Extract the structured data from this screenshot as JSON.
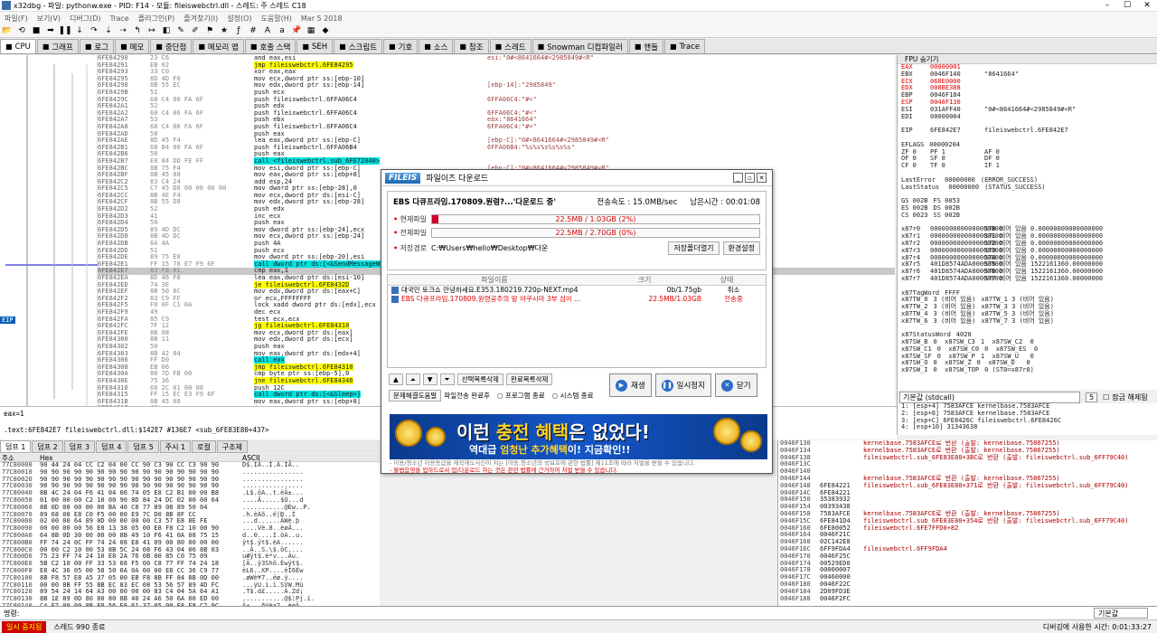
{
  "window": {
    "title": "x32dbg - 파일: pythonw.exe - PID: F14 - 모듈: fileiswebctrl.dll - 스레드: 주 스레드 C18"
  },
  "menu": [
    "파일(F)",
    "보기(V)",
    "디버그(D)",
    "Trace",
    "플러그인(P)",
    "즐겨찾기(I)",
    "설정(O)",
    "도움말(H)",
    "Mar 5 2018"
  ],
  "tabs": [
    {
      "label": "CPU",
      "active": true
    },
    {
      "label": "그래프"
    },
    {
      "label": "로그"
    },
    {
      "label": "메모"
    },
    {
      "label": "중단점"
    },
    {
      "label": "메모리 맵"
    },
    {
      "label": "호출 스택"
    },
    {
      "label": "SEH"
    },
    {
      "label": "스크립트"
    },
    {
      "label": "기호"
    },
    {
      "label": "소스"
    },
    {
      "label": "참조"
    },
    {
      "label": "스레드"
    },
    {
      "label": "Snowman 디컴파일러"
    },
    {
      "label": "핸들"
    },
    {
      "label": "Trace"
    }
  ],
  "disasm": [
    {
      "a": "6FE84290",
      "b": "23 C6",
      "d": "and eax,esi",
      "c": "esi:\"0#<8641664#<2985849#<R\""
    },
    {
      "a": "6FE84291",
      "b": "EB 02",
      "d": "jmp fileiswebctrl.6FE84295",
      "c": "",
      "y": 1
    },
    {
      "a": "6FE84293",
      "b": "33 C0",
      "d": "xor eax,eax",
      "c": ""
    },
    {
      "a": "6FE84295",
      "b": "8D 4D F0",
      "d": "mov ecx,dword ptr ss:[ebp-10]",
      "c": ""
    },
    {
      "a": "6FE84298",
      "b": "8B 55 EC",
      "d": "mov edx,dword ptr ss:[ebp-14]",
      "c": "[ebp-14]:\"2985849\""
    },
    {
      "a": "6FE8429B",
      "b": "51",
      "d": "push ecx",
      "c": ""
    },
    {
      "a": "6FE8429C",
      "b": "68 C4 06 FA 6F",
      "d": "push fileiswebctrl.6FFA06C4",
      "c": "6FFA06C4:\"#<\""
    },
    {
      "a": "6FE842A1",
      "b": "52",
      "d": "push edx",
      "c": ""
    },
    {
      "a": "6FE842A2",
      "b": "68 C4 06 FA 6F",
      "d": "push fileiswebctrl.6FFA06C4",
      "c": "6FFA06C4:\"#<\""
    },
    {
      "a": "6FE842A7",
      "b": "53",
      "d": "push ebx",
      "c": "ebx:\"8641664\""
    },
    {
      "a": "6FE842A8",
      "b": "68 C4 06 FA 6F",
      "d": "push fileiswebctrl.6FFA06C4",
      "c": "6FFA06C4:\"#<\""
    },
    {
      "a": "6FE842AD",
      "b": "50",
      "d": "push eax",
      "c": ""
    },
    {
      "a": "6FE842AE",
      "b": "8D 45 F4",
      "d": "lea eax,dword ptr ss:[ebp-C]",
      "c": "[ebp-C]:\"0#<8641664#<2985849#<R\""
    },
    {
      "a": "6FE842B1",
      "b": "68 B4 06 FA 6F",
      "d": "push fileiswebctrl.6FFA06B4",
      "c": "6FFA06B4:\"%s%s%s%s%s%s\""
    },
    {
      "a": "6FE842B6",
      "b": "50",
      "d": "push eax",
      "c": ""
    },
    {
      "a": "6FE842B7",
      "b": "E8 84 DD FE FF",
      "d": "call <fileiswebctrl.sub_6FE72040>",
      "c": "",
      "y": 1
    },
    {
      "a": "6FE842BC",
      "b": "8B 75 F4",
      "d": "mov esi,dword ptr ss:[ebp-C]",
      "c": "[ebp-C]:\"0#<8641664#<2985849#<R\""
    },
    {
      "a": "6FE842BF",
      "b": "8B 45 08",
      "d": "mov eax,dword ptr ss:[ebp+8]",
      "c": ""
    },
    {
      "a": "6FE842C2",
      "b": "83 C4 24",
      "d": "add esp,24",
      "c": ""
    },
    {
      "a": "6FE842C5",
      "b": "C7 45 D8 00 00 00 00",
      "d": "mov dword ptr ss:[ebp-28],0",
      "c": ""
    },
    {
      "a": "6FE842CC",
      "b": "8B 4E F4",
      "d": "mov ecx,dword ptr ds:[esi-C]",
      "c": ""
    },
    {
      "a": "6FE842CF",
      "b": "8B 55 D8",
      "d": "mov edx,dword ptr ss:[ebp-28]",
      "c": ""
    },
    {
      "a": "6FE842D2",
      "b": "52",
      "d": "push edx",
      "c": ""
    },
    {
      "a": "6FE842D3",
      "b": "41",
      "d": "inc ecx",
      "c": ""
    },
    {
      "a": "6FE842D4",
      "b": "50",
      "d": "push eax",
      "c": ""
    },
    {
      "a": "6FE842D5",
      "b": "89 4D DC",
      "d": "mov dword ptr ss:[ebp-24],ecx",
      "c": ""
    },
    {
      "a": "6FE842D8",
      "b": "8B 4D DC",
      "d": "mov ecx,dword ptr ss:[ebp-24]",
      "c": ""
    },
    {
      "a": "6FE842DB",
      "b": "6A 4A",
      "d": "push 4A",
      "c": ""
    },
    {
      "a": "6FE842DD",
      "b": "51",
      "d": "push ecx",
      "c": ""
    },
    {
      "a": "6FE842DE",
      "b": "89 75 E0",
      "d": "mov dword ptr ss:[ebp-20],esi",
      "c": ""
    },
    {
      "a": "6FE842E1",
      "b": "FF 15 78 E7 F9 6F",
      "d": "call dword ptr ds:[<&SendMessageW>]",
      "c": "",
      "y": 1
    },
    {
      "a": "6FE842E7",
      "b": "83 F8 01",
      "d": "cmp eax,1",
      "c": "",
      "hl": 1
    },
    {
      "a": "6FE842EA",
      "b": "8D 46 F0",
      "d": "lea eax,dword ptr ds:[esi-10]",
      "c": ""
    },
    {
      "a": "6FE842ED",
      "b": "74 3E",
      "d": "je fileiswebctrl.6FE8432D",
      "c": "",
      "y": 1
    },
    {
      "a": "6FE842EF",
      "b": "8B 50 0C",
      "d": "mov edx,dword ptr ds:[eax+C]",
      "c": ""
    },
    {
      "a": "6FE842F2",
      "b": "83 C9 FF",
      "d": "or ecx,FFFFFFFF",
      "c": ""
    },
    {
      "a": "6FE842F5",
      "b": "F0 0F C1 0A",
      "d": "lock xadd dword ptr ds:[edx],ecx",
      "c": ""
    },
    {
      "a": "6FE842F9",
      "b": "49",
      "d": "dec ecx",
      "c": ""
    },
    {
      "a": "6FE842FA",
      "b": "85 C9",
      "d": "test ecx,ecx",
      "c": ""
    },
    {
      "a": "6FE842FC",
      "b": "7F 12",
      "d": "jg fileiswebctrl.6FE84310",
      "c": "",
      "y": 1
    },
    {
      "a": "6FE842FE",
      "b": "8B 08",
      "d": "mov ecx,dword ptr ds:[eax]",
      "c": ""
    },
    {
      "a": "6FE84300",
      "b": "8B 11",
      "d": "mov edx,dword ptr ds:[ecx]",
      "c": ""
    },
    {
      "a": "6FE84302",
      "b": "50",
      "d": "push eax",
      "c": ""
    },
    {
      "a": "6FE84303",
      "b": "8B 42 04",
      "d": "mov eax,dword ptr ds:[edx+4]",
      "c": ""
    },
    {
      "a": "6FE84306",
      "b": "FF D0",
      "d": "call eax",
      "c": "",
      "y": 1
    },
    {
      "a": "6FE84308",
      "b": "EB 06",
      "d": "jmp fileiswebctrl.6FE84310",
      "c": "",
      "y": 1
    },
    {
      "a": "6FE8430A",
      "b": "80 7D FB 00",
      "d": "cmp byte ptr ss:[ebp-5],0",
      "c": ""
    },
    {
      "a": "6FE8430E",
      "b": "75 36",
      "d": "jne fileiswebctrl.6FE84346",
      "c": "",
      "y": 1
    },
    {
      "a": "6FE84310",
      "b": "68 2C 01 00 00",
      "d": "push 12C",
      "c": ""
    },
    {
      "a": "6FE84315",
      "b": "FF 15 EC E3 F9 6F",
      "d": "call dword ptr ds:[<&Sleep>]",
      "c": "",
      "y": 1
    },
    {
      "a": "6FE8431B",
      "b": "8B 45 08",
      "d": "mov eax,dword ptr ss:[ebp+8]",
      "c": ""
    },
    {
      "a": "6FE8431E",
      "b": "40",
      "d": "inc eax",
      "c": ""
    }
  ],
  "eip_label": "EIP",
  "regs": {
    "header": "FPU 숨기기",
    "lines": [
      {
        "n": "EAX",
        "v": "00000001",
        "c": "",
        "r": 1
      },
      {
        "n": "EBX",
        "v": "0046F140",
        "c": "\"8641664\""
      },
      {
        "n": "ECX",
        "v": "068E0000",
        "c": "",
        "r": 1
      },
      {
        "n": "EDX",
        "v": "008BE388",
        "c": "",
        "r": 1
      },
      {
        "n": "EBP",
        "v": "0046F184",
        "c": ""
      },
      {
        "n": "ESP",
        "v": "0046F130",
        "c": "",
        "r": 1
      },
      {
        "n": "ESI",
        "v": "031AFF40",
        "c": "\"0#<8641664#<2985849#<R\""
      },
      {
        "n": "EDI",
        "v": "00000004",
        "c": ""
      },
      {
        "n": "",
        "v": "",
        "c": ""
      },
      {
        "n": "EIP",
        "v": "6FE842E7",
        "c": "fileiswebctrl.6FE842E7"
      },
      {
        "n": "",
        "v": "",
        "c": ""
      },
      {
        "n": "EFLAGS",
        "v": "00000204",
        "c": ""
      },
      {
        "n": "ZF 0",
        "v": "PF 1",
        "c": "AF 0"
      },
      {
        "n": "OF 0",
        "v": "SF 0",
        "c": "DF 0"
      },
      {
        "n": "CF 0",
        "v": "TF 0",
        "c": "IF 1"
      },
      {
        "n": "",
        "v": "",
        "c": ""
      },
      {
        "n": "LastError",
        "v": " 00000000",
        "c": "(ERROR_SUCCESS)"
      },
      {
        "n": "LastStatus",
        "v": " 00000000",
        "c": "(STATUS_SUCCESS)"
      },
      {
        "n": "",
        "v": "",
        "c": ""
      },
      {
        "n": "GS 002B",
        "v": "FS 0053",
        "c": ""
      },
      {
        "n": "ES 002B",
        "v": "DS 002B",
        "c": ""
      },
      {
        "n": "CS 0023",
        "v": "SS 002B",
        "c": ""
      },
      {
        "n": "",
        "v": "",
        "c": ""
      },
      {
        "n": "x87r0",
        "v": "0000000000000000000",
        "c": "ST0 비어 있음 0.00000000000000000"
      },
      {
        "n": "x87r1",
        "v": "0000000000000000000",
        "c": "ST1 비어 있음 0.00000000000000000"
      },
      {
        "n": "x87r2",
        "v": "0000000000000000000",
        "c": "ST2 비어 있음 0.00000000000000000"
      },
      {
        "n": "x87r3",
        "v": "0000000000000000000",
        "c": "ST3 비어 있음 0.00000000000000000"
      },
      {
        "n": "x87r4",
        "v": "0000000000000000000",
        "c": "ST4 비어 있음 0.00000000000000000"
      },
      {
        "n": "x87r5",
        "v": "401D8574ADA00000000",
        "c": "ST5 비어 있음 1522161360.00000000"
      },
      {
        "n": "x87r6",
        "v": "401D8574ADA00000000",
        "c": "ST6 비어 있음 1522161360.00000000"
      },
      {
        "n": "x87r7",
        "v": "401D8574ADA00000000",
        "c": "ST7 비어 있음 1522161360.00000000"
      },
      {
        "n": "",
        "v": "",
        "c": ""
      },
      {
        "n": "x87TagWord",
        "v": "FFFF",
        "c": ""
      },
      {
        "n": "x87TW_0",
        "v": "3 (비어 있음)",
        "c": "x87TW_1 3 (비어 있음)"
      },
      {
        "n": "x87TW_2",
        "v": "3 (비어 있음)",
        "c": "x87TW_3 3 (비어 있음)"
      },
      {
        "n": "x87TW_4",
        "v": "3 (비어 있음)",
        "c": "x87TW_5 3 (비어 있음)"
      },
      {
        "n": "x87TW_6",
        "v": "3 (비어 있음)",
        "c": "x87TW_7 3 (비어 있음)"
      },
      {
        "n": "",
        "v": "",
        "c": ""
      },
      {
        "n": "x87StatusWord",
        "v": "4020",
        "c": ""
      },
      {
        "n": "x87SW_B",
        "v": "0  x87SW_C3",
        "c": "1  x87SW_C2  0"
      },
      {
        "n": "x87SW_C1",
        "v": "0  x87SW_C0",
        "c": "0  x87SW_ES  0"
      },
      {
        "n": "x87SW_SF",
        "v": "0  x87SW_P",
        "c": "1  x87SW_U   0"
      },
      {
        "n": "x87SW_O",
        "v": "0  x87SW_Z",
        "c": "0  x87SW_D   0"
      },
      {
        "n": "x87SW_I",
        "v": "0  x87SW_TOP",
        "c": "0 (ST0=x87r0)"
      }
    ]
  },
  "regctl": {
    "conv": "기본값 (stdcall)",
    "argc": "5",
    "lock": "잠금 해제됨"
  },
  "callstack": [
    "1: [esp+4] 7583AFCE kernelbase.7583AFCE",
    "2: [esp+8] 7583AFCE kernelbase.7583AFCE",
    "3: [esp+C] 6FE8426C fileiswebctrl.6FE8426C",
    "4: [esp+10] 31343638"
  ],
  "info": {
    "line1": "eax=1",
    "line2": ".text:6FE842E7 fileiswebctrl.dll:$142E7 #136E7 <sub_6FE83E80+437>"
  },
  "dumptabs": [
    "덤프 1",
    "덤프 2",
    "덤프 3",
    "덤프 4",
    "덤프 5",
    "주시 1",
    "로컬",
    "구조체"
  ],
  "dump": {
    "h1": "주소",
    "h2": "Hex",
    "h3": "ASCII",
    "rows": [
      {
        "a": "77C80000",
        "h": "90 44 24 04 CC C2 04 00 CC 90 C3 90 CC C3 90 90",
        "s": "D$.IÄ..Ì.À.ÌÃ.."
      },
      {
        "a": "77C80010",
        "h": "90 90 90 90 90 90 90 90 90 90 90 90 90 90 90 90",
        "s": "................"
      },
      {
        "a": "77C80020",
        "h": "90 90 90 90 90 90 90 90 90 90 90 90 90 90 90 90",
        "s": "................"
      },
      {
        "a": "77C80030",
        "h": "90 90 90 90 90 90 90 90 90 90 90 90 90 90 90 90",
        "s": "................"
      },
      {
        "a": "77C80040",
        "h": "8B 4C 24 04 F6 41 04 06 74 05 E8 C2 B1 00 00 B8",
        "s": ".L$.öA..t.èÂ±..."
      },
      {
        "a": "77C80050",
        "h": "01 00 00 00 C2 10 00 90 8D 84 24 DC 02 00 00 64",
        "s": "....Â.....$Ü...d"
      },
      {
        "a": "77C80060",
        "h": "8B 0D 00 00 00 00 BA 40 C8 77 89 08 89 50 04",
        "s": "...........@Èw..P."
      },
      {
        "a": "77C80070",
        "h": "89 68 08 E8 C0 F5 00 00 E9 7C D0 8B 8F CC",
        "s": ".h.èÀõ..é|Ð..Ì"
      },
      {
        "a": "77C80080",
        "h": "02 00 00 64 89 0D 00 00 00 00 C3 57 E8 8E FE",
        "s": "...d......ÃWè.þ"
      },
      {
        "a": "77C80090",
        "h": "00 00 00 00 56 E8 13 38 05 00 E8 F8 C2 10 00 90",
        "s": "....Vè.8..èøÂ..."
      },
      {
        "a": "77C800A0",
        "h": "64 8B 0D 30 00 00 00 8B 49 10 F6 41 0A 08 75 15",
        "s": "d..0....I.öA..u."
      },
      {
        "a": "77C800B0",
        "h": "FF 74 24 0C FF 74 24 08 E8 41 09 00 80 00 00 00",
        "s": "ÿt$.ÿt$.èA......"
      },
      {
        "a": "77C800C0",
        "h": "00 00 C2 10 00 53 8B 5C 24 08 F6 43 04 06 8B 03",
        "s": "..Â..S.\\$.öC...."
      },
      {
        "a": "77C800D0",
        "h": "75 23 FF 74 24 10 E8 2A 76 0B 00 85 C0 75 09",
        "s": "u#ÿt$.è*v...Àu."
      },
      {
        "a": "77C800E0",
        "h": "5B C2 10 00 FF 33 53 68 F5 00 C8 77 FF 74 24 18",
        "s": "[Â..ÿ3Shõ.Èwÿt$."
      },
      {
        "a": "77C800F0",
        "h": "E8 4C 36 05 00 58 50 0A 0A 00 00 E8 CC 36 C9 77",
        "s": "èL6..XP....èÌ6Éw"
      },
      {
        "a": "77C80100",
        "h": "8B F8 57 E8 A5 37 05 00 EB F8 8B FF 84 8B 0D 00",
        "s": ".øWè¥7..ëø.ÿ...."
      },
      {
        "a": "77C80110",
        "h": "00 00 8B FF 55 8B EC 83 EC 08 53 56 57 89 4D FC",
        "s": "...ÿU.ì.ì.SVW.Mü"
      },
      {
        "a": "77C80120",
        "h": "89 54 24 14 64 A3 00 00 00 00 83 C4 04 5A 64 A1",
        "s": ".T$.d£.....Ä.Zd¡"
      },
      {
        "a": "77C80130",
        "h": "8B 1E 89 0D 80 80 80 8B 40 24 A6 50 6A 00 ED 00",
        "s": "...........@$¦Pj.í."
      },
      {
        "a": "77C80140",
        "h": "C4 F7 00 00 8B F0 56 E8 61 37 05 00 E8 F8 C2 9C",
        "s": "Ä÷...ðVèa7..èøÂ."
      }
    ]
  },
  "stack": [
    {
      "a": "0046F130",
      "v": "",
      "c": "kernelbase.7583AFCE로 반환 (출발: kernelbase.75867255)"
    },
    {
      "a": "0046F134",
      "v": "",
      "c": "kernelbase.7583AFCE로 반환 (출발: kernelbase.75867255)"
    },
    {
      "a": "0046F138",
      "v": "",
      "c": "fileiswebctrl.sub_6FE83E80+3BC로 반환 (출발: fileiswebctrl.sub_6FF79C40)"
    },
    {
      "a": "0046F13C",
      "v": "",
      "c": ""
    },
    {
      "a": "0046F140",
      "v": "",
      "c": ""
    },
    {
      "a": "0046F144",
      "v": "",
      "c": "kernelbase.7583AFCE로 반환 (출발: kernelbase.75867255)"
    },
    {
      "a": "0046F148",
      "v": "6FE84221",
      "c": "fileiswebctrl.sub_6FE83E80+371로 반환 (출발: fileiswebctrl.sub_6FF79C40)"
    },
    {
      "a": "0046F14C",
      "v": "6FE84221",
      "c": ""
    },
    {
      "a": "0046F150",
      "v": "35383932",
      "c": ""
    },
    {
      "a": "0046F154",
      "v": "00393438",
      "c": ""
    },
    {
      "a": "0046F158",
      "v": "7583AFCE",
      "c": "kernelbase.7583AFCE로 반환 (출발: kernelbase.75867255)"
    },
    {
      "a": "0046F15C",
      "v": "6FE841D4",
      "c": "fileiswebctrl.sub_6FE83E80+354로 반환 (출발: fileiswebctrl.sub_6FF79C40)"
    },
    {
      "a": "0046F160",
      "v": "6FE80052",
      "c": "fileiswebctrl.6FE7FFD0+82"
    },
    {
      "a": "0046F164",
      "v": "0046F21C",
      "c": ""
    },
    {
      "a": "0046F168",
      "v": "02C142E8",
      "c": ""
    },
    {
      "a": "0046F16C",
      "v": "6FF9FDA4",
      "c": "fileiswebctrl.6FF9FDA4"
    },
    {
      "a": "0046F170",
      "v": "0046F25C",
      "c": ""
    },
    {
      "a": "0046F174",
      "v": "00529ED0",
      "c": ""
    },
    {
      "a": "0046F178",
      "v": "00000007",
      "c": ""
    },
    {
      "a": "0046F17C",
      "v": "00460000",
      "c": ""
    },
    {
      "a": "0046F180",
      "v": "0046F22C",
      "c": ""
    },
    {
      "a": "0046F184",
      "v": "2D09FD3E",
      "c": ""
    },
    {
      "a": "0046F188",
      "v": "0046F2FC",
      "c": ""
    }
  ],
  "cmd": {
    "label": "명령:",
    "default": "기본값"
  },
  "status": {
    "paused": "일시 중지됨",
    "msg": "스레드 990 종료",
    "time": "디버깅에 사용한 시간: 0:01:33:27"
  },
  "dialog": {
    "logo": "FILEIS",
    "title": "파일이즈 다운로드",
    "file": "EBS 다큐프라임.170809.원령?...'다운로드 중'",
    "speed": "전송속도 : 15.0MB/sec",
    "remain": "남은시간 : 00:01:08",
    "cur_label": "현재파일",
    "cur_text": "22.5MB / 1.03GB (2%)",
    "cur_progress": 0.02,
    "all_label": "전체파일",
    "all_text": "22.5MB / 2.70GB (0%)",
    "all_progress": 0.0,
    "save_label": "저장경로",
    "save_path": "C:₩Users₩hello₩Desktop₩다운",
    "open_folder": "저장폴더열기",
    "env": "환경설정",
    "col_name": "파일이름",
    "col_size": "크기",
    "col_state": "상태",
    "rows": [
      {
        "name": "대국민 토크쇼 안녕하세요.E353.180219.720p-NEXT.mp4",
        "size": "0b/1.75gb",
        "state": "취소",
        "red": false
      },
      {
        "name": "EBS 다큐프라임.170809.원령공주의 땅 야쿠시마 3부 섬이 ...",
        "size": "22.5MB/1.03GB",
        "state": "전송중",
        "red": true
      }
    ],
    "btn_del_sel": "선택목록삭제",
    "btn_del_done": "완료목록삭제",
    "btn_report": "문제해결도움말",
    "opt1": "파일전송 완료후",
    "opt2": "프로그램 종료",
    "opt3": "시스템 종료",
    "btn_play": "재생",
    "btn_pause": "일시정지",
    "btn_close": "닫기",
    "banner1a": "이런 ",
    "banner1b": "충전 혜택",
    "banner1c": "은 없었다!",
    "banner2a": "역대급 ",
    "banner2b": "엄청난 추가혜택",
    "banner2c": "이! 지금확인!!",
    "note1": "- 이용/청소년 이용등급을 제작해도사진이 저는 [아동,청소년의 성보호에 관한 법률] 제11조에 따라 처벌을 받을 수 있습니다.",
    "note2": "- 불법음영을 업하드로서 업/다운로드 하는 것은 관련 법률에 근거하여 처벌 받을 수 있습니다."
  }
}
